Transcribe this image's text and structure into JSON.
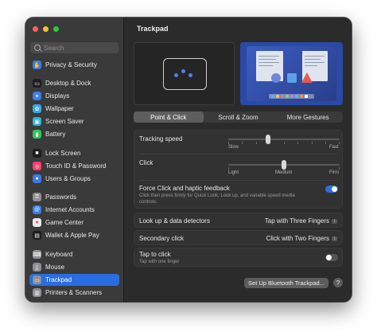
{
  "sidebar": {
    "search_placeholder": "Search",
    "items": [
      {
        "label": "Privacy & Security",
        "icon": "hand-icon",
        "color": "#3b7be6"
      },
      {
        "label": "Desktop & Dock",
        "icon": "dock-icon",
        "color": "#1c1c1e"
      },
      {
        "label": "Displays",
        "icon": "sun-icon",
        "color": "#3b7be6"
      },
      {
        "label": "Wallpaper",
        "icon": "flower-icon",
        "color": "#3ba7e6"
      },
      {
        "label": "Screen Saver",
        "icon": "screen-saver-icon",
        "color": "#2fb0d6"
      },
      {
        "label": "Battery",
        "icon": "battery-icon",
        "color": "#34c759"
      },
      {
        "label": "Lock Screen",
        "icon": "lock-icon",
        "color": "#1c1c1e"
      },
      {
        "label": "Touch ID & Password",
        "icon": "fingerprint-icon",
        "color": "#ff3b6b"
      },
      {
        "label": "Users & Groups",
        "icon": "users-icon",
        "color": "#3b7be6"
      },
      {
        "label": "Passwords",
        "icon": "key-icon",
        "color": "#8e8e93"
      },
      {
        "label": "Internet Accounts",
        "icon": "at-icon",
        "color": "#3b7be6"
      },
      {
        "label": "Game Center",
        "icon": "game-center-icon",
        "color": "#e8e8e8"
      },
      {
        "label": "Wallet & Apple Pay",
        "icon": "wallet-icon",
        "color": "#1c1c1e"
      },
      {
        "label": "Keyboard",
        "icon": "keyboard-icon",
        "color": "#8e8e93"
      },
      {
        "label": "Mouse",
        "icon": "mouse-icon",
        "color": "#8e8e93"
      },
      {
        "label": "Trackpad",
        "icon": "trackpad-icon",
        "color": "#8e8e93"
      },
      {
        "label": "Printers & Scanners",
        "icon": "printer-icon",
        "color": "#8e8e93"
      }
    ],
    "selected": "Trackpad"
  },
  "main": {
    "title": "Trackpad",
    "tabs": [
      {
        "label": "Point & Click",
        "active": true
      },
      {
        "label": "Scroll & Zoom",
        "active": false
      },
      {
        "label": "More Gestures",
        "active": false
      }
    ],
    "tracking_speed": {
      "label": "Tracking speed",
      "min_label": "Slow",
      "max_label": "Fast",
      "value_fraction": 0.36
    },
    "click": {
      "label": "Click",
      "min_label": "Light",
      "mid_label": "Medium",
      "max_label": "Firm",
      "value_fraction": 0.5
    },
    "force_click": {
      "label": "Force Click and haptic feedback",
      "description": "Click then press firmly for Quick Look, Look up, and variable speed media controls.",
      "enabled": true
    },
    "lookup": {
      "label": "Look up & data detectors",
      "value": "Tap with Three Fingers"
    },
    "secondary_click": {
      "label": "Secondary click",
      "value": "Click with Two Fingers"
    },
    "tap_to_click": {
      "label": "Tap to click",
      "description": "Tap with one finger",
      "enabled": false
    },
    "bluetooth_button": "Set Up Bluetooth Trackpad...",
    "help_label": "?"
  },
  "colors": {
    "accent": "#2b6de0",
    "window_bg": "#2b2b2b",
    "sidebar_bg": "#3a3a3a"
  }
}
